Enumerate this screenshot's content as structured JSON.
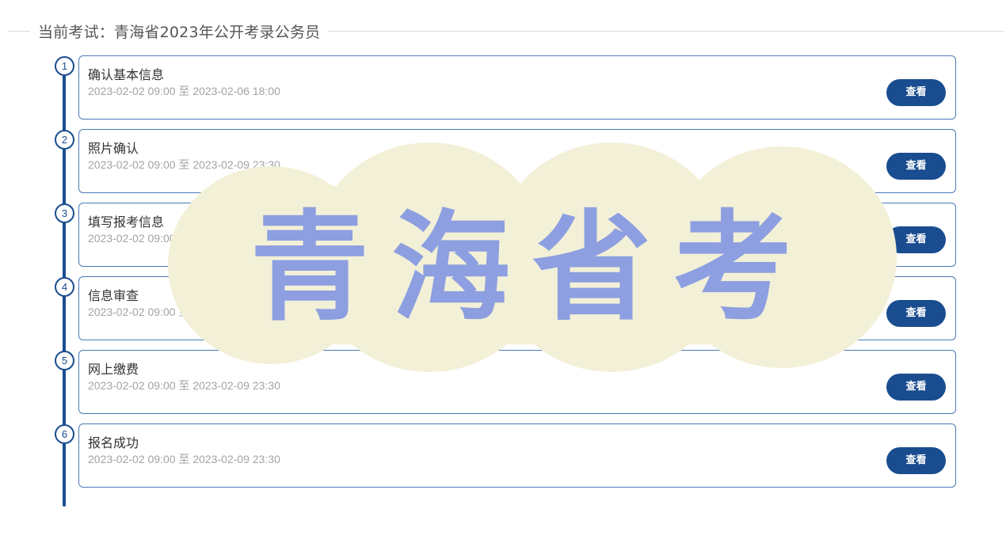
{
  "header": {
    "title": "当前考试：青海省2023年公开考录公务员"
  },
  "steps": [
    {
      "number": "1",
      "title": "确认基本信息",
      "date": "2023-02-02 09:00 至 2023-02-06 18:00",
      "button": "查看"
    },
    {
      "number": "2",
      "title": "照片确认",
      "date": "2023-02-02 09:00 至 2023-02-09 23:30",
      "button": "查看"
    },
    {
      "number": "3",
      "title": "填写报考信息",
      "date": "2023-02-02 09:00 至 2023-02-09 23:30",
      "button": "查看"
    },
    {
      "number": "4",
      "title": "信息审查",
      "date": "2023-02-02 09:00 至 2023-02-09 23:30",
      "button": "查看"
    },
    {
      "number": "5",
      "title": "网上缴费",
      "date": "2023-02-02 09:00 至 2023-02-09 23:30",
      "button": "查看"
    },
    {
      "number": "6",
      "title": "报名成功",
      "date": "2023-02-02 09:00 至 2023-02-09 23:30",
      "button": "查看"
    }
  ],
  "watermark": {
    "text": "青海省考"
  },
  "colors": {
    "accent": "#1a4d8f",
    "card_border": "#4a7ab7",
    "watermark_bg": "#f3f0d8",
    "watermark_text": "#8d9fe0"
  }
}
